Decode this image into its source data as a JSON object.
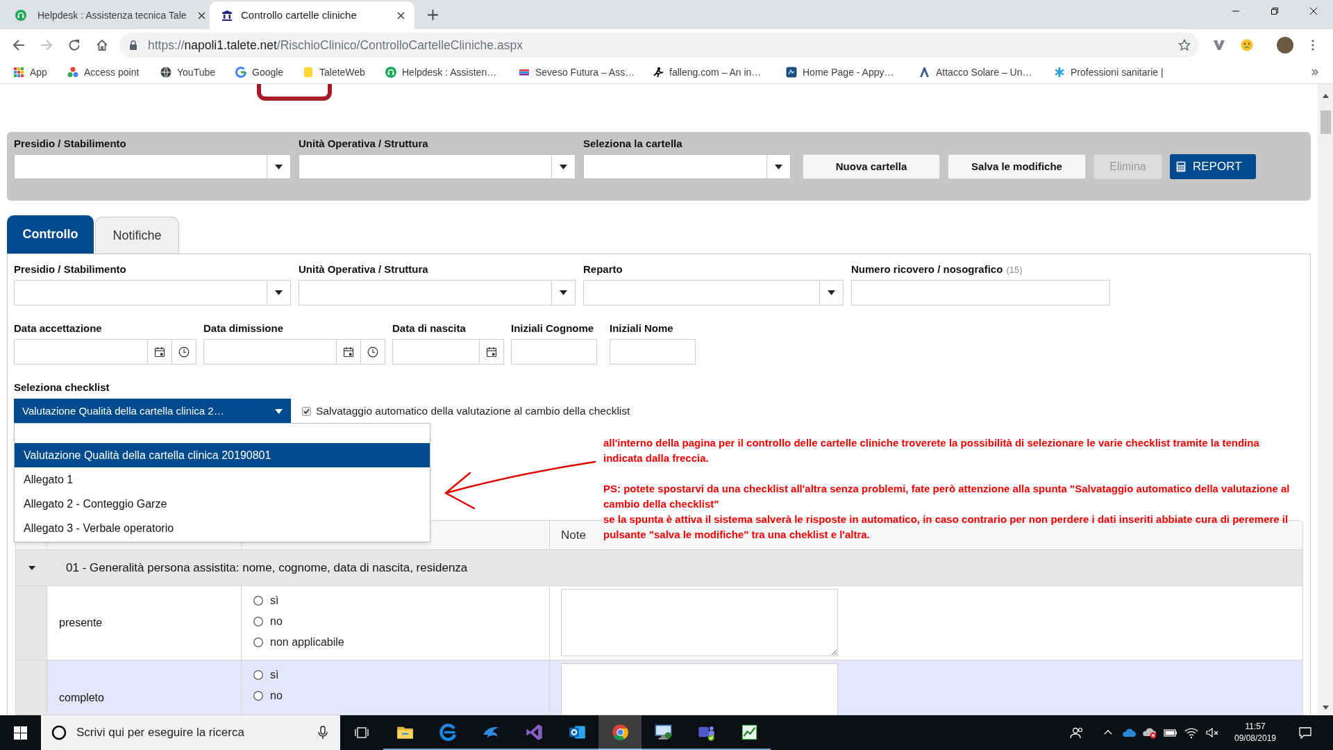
{
  "browser": {
    "tabs": [
      {
        "title": "Helpdesk : Assistenza tecnica Tale",
        "selected": false
      },
      {
        "title": "Controllo cartelle cliniche",
        "selected": true
      }
    ],
    "address": {
      "scheme": "https://",
      "host": "napoli1.talete.net",
      "path": "/RischioClinico/ControlloCartelleCliniche.aspx"
    },
    "bookmarks": [
      "App",
      "Access point",
      "YouTube",
      "Google",
      "TaleteWeb",
      "Helpdesk : Assisten…",
      "Seveso Futura – Ass…",
      "falleng.com – An in…",
      "Home Page - Appy…",
      "Attacco Solare – Un…",
      "Professioni sanitarie |"
    ]
  },
  "filter_bar": {
    "fields": [
      "Presidio / Stabilimento",
      "Unità Operativa / Struttura",
      "Seleziona la cartella"
    ],
    "buttons": [
      {
        "label": "Nuova cartella",
        "kind": "default",
        "disabled": false
      },
      {
        "label": "Salva le modifiche",
        "kind": "default",
        "disabled": false
      },
      {
        "label": "Elimina",
        "kind": "default",
        "disabled": true
      },
      {
        "label": "REPORT",
        "kind": "primary",
        "disabled": false
      }
    ]
  },
  "tabs": [
    {
      "label": "Controllo",
      "selected": true
    },
    {
      "label": "Notifiche",
      "selected": false
    }
  ],
  "form": {
    "rows": [
      [
        {
          "label": "Presidio / Stabilimento",
          "kind": "select"
        },
        {
          "label": "Unità Operativa / Struttura",
          "kind": "select"
        },
        {
          "label": "Reparto",
          "kind": "select"
        },
        {
          "label": "Numero ricovero / nosografico",
          "hint": "(15)",
          "kind": "text"
        }
      ],
      [
        {
          "label": "Data accettazione",
          "kind": "datetime"
        },
        {
          "label": "Data dimissione",
          "kind": "datetime"
        },
        {
          "label": "Data di nascita",
          "kind": "date"
        },
        {
          "label": "Iniziali Cognome",
          "kind": "text"
        },
        {
          "label": "Iniziali Nome",
          "kind": "text"
        }
      ]
    ]
  },
  "checklist": {
    "label": "Seleziona checklist",
    "value": "Valutazione Qualità della cartella clinica 2…",
    "expanded": true,
    "options": [
      {
        "label": "Valutazione Qualità della cartella clinica 20190801",
        "selected": true
      },
      {
        "label": "Allegato 1",
        "selected": false
      },
      {
        "label": "Allegato 2 - Conteggio Garze",
        "selected": false
      },
      {
        "label": "Allegato 3 - Verbale operatorio",
        "selected": false
      }
    ],
    "autosave": {
      "label": "Salvataggio automatico della valutazione al cambio della checklist",
      "checked": true
    }
  },
  "annotation": {
    "blocks": [
      [
        "all'interno della pagina per il controllo delle cartelle cliniche troverete la possibilità di selezionare le varie checklist tramite la tendina indicata dalla freccia."
      ],
      [
        "PS: potete spostarvi da una checklist all'altra senza problemi, fate però attenzione alla spunta \"Salvataggio automatico della valutazione al cambio della checklist\"",
        "se la spunta è attiva il sistema salverà le risposte in automatico, in caso contrario per non perdere i dati inseriti abbiate cura di peremere il pulsante \"salva le modifiche\" tra una cheklist e l'altra."
      ]
    ]
  },
  "table": {
    "note_header": "Note",
    "groups": [
      {
        "title": "01 - Generalità persona assistita: nome, cognome, data di nascita, residenza",
        "expanded": true,
        "rows": [
          {
            "label": "presente",
            "options": [
              {
                "label": "sì",
                "selected": false
              },
              {
                "label": "no",
                "selected": false
              },
              {
                "label": "non applicabile",
                "selected": false
              }
            ]
          },
          {
            "label": "completo",
            "options": [
              {
                "label": "sì",
                "selected": false
              },
              {
                "label": "no",
                "selected": false
              }
            ]
          }
        ]
      }
    ]
  },
  "taskbar": {
    "search": {
      "placeholder": "Scrivi qui per eseguire la ricerca"
    },
    "apps": [
      {
        "selected": false
      },
      {
        "selected": false
      },
      {
        "selected": false
      },
      {
        "selected": false
      },
      {
        "selected": false
      },
      {
        "selected": true
      },
      {
        "selected": false
      },
      {
        "selected": false
      },
      {
        "selected": false
      }
    ],
    "clock": {
      "time": "11:57",
      "date": "09/08/2019"
    }
  }
}
